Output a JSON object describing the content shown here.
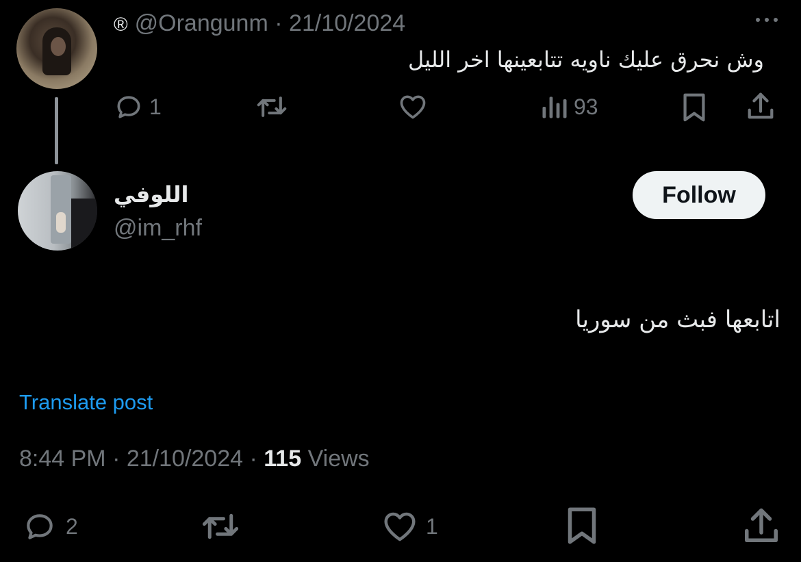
{
  "parent_tweet": {
    "registered_mark": "®",
    "handle": "@Orangunm",
    "separator": "·",
    "date": "21/10/2024",
    "text": "وش نحرق عليك ناويه تتابعينها اخر الليل",
    "actions": {
      "reply_icon": "reply-bubble-icon",
      "reply_count": "1",
      "retweet_icon": "retweet-icon",
      "like_icon": "heart-icon",
      "views_icon": "bar-chart-icon",
      "views_count": "93",
      "bookmark_icon": "bookmark-icon",
      "share_icon": "share-icon"
    }
  },
  "reply_tweet": {
    "display_name": "اللوفي",
    "handle": "@im_rhf",
    "follow_label": "Follow",
    "text": "اتابعها فبث من سوريا",
    "translate_label": "Translate post",
    "time": "8:44 PM",
    "separator": "·",
    "date": "21/10/2024",
    "views_count": "115",
    "views_label": "Views",
    "actions": {
      "reply_count": "2",
      "like_count": "1"
    }
  },
  "colors": {
    "background": "#000000",
    "text_primary": "#e7e9ea",
    "text_secondary": "#71767b",
    "link": "#1d9bf0",
    "follow_bg": "#eff3f4"
  }
}
